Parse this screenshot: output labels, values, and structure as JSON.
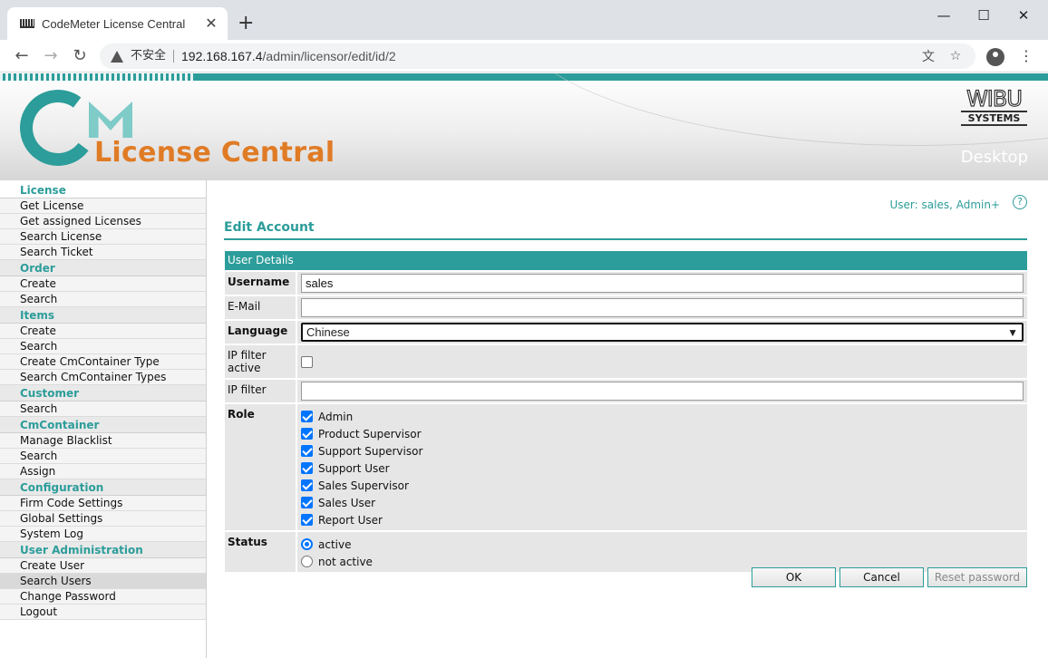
{
  "browser": {
    "tab_title": "CodeMeter License Central",
    "tab_close": "✕",
    "new_tab": "+",
    "minimize": "—",
    "maximize": "☐",
    "close": "✕",
    "back": "←",
    "forward": "→",
    "reload": "↻",
    "insecure_label": "不安全",
    "url_host": "192.168.167.4",
    "url_path": "/admin/licensor/edit/id/2",
    "translate_icon": "文",
    "star_icon": "☆",
    "menu_icon": "⋮"
  },
  "header": {
    "brand": "License Central",
    "vendor_top": "WIBU",
    "vendor_bottom": "SYSTEMS",
    "edition": "Desktop",
    "colors": {
      "teal": "#2c9d9a",
      "orange": "#e07b25",
      "light_teal": "#7ecbc8"
    }
  },
  "sidebar": {
    "license": {
      "title": "License",
      "items": [
        "Get License",
        "Get assigned Licenses",
        "Search License",
        "Search Ticket"
      ]
    },
    "order": {
      "title": "Order",
      "items": [
        "Create",
        "Search"
      ]
    },
    "items": {
      "title": "Items",
      "items": [
        "Create",
        "Search",
        "Create CmContainer Type",
        "Search CmContainer Types"
      ]
    },
    "customer": {
      "title": "Customer",
      "items": [
        "Search"
      ]
    },
    "cmcontainer": {
      "title": "CmContainer",
      "items": [
        "Manage Blacklist",
        "Search",
        "Assign"
      ]
    },
    "configuration": {
      "title": "Configuration",
      "items": [
        "Firm Code Settings",
        "Global Settings",
        "System Log"
      ]
    },
    "useradmin": {
      "title": "User Administration",
      "items": [
        "Create User",
        "Search Users",
        "Change Password",
        "Logout"
      ],
      "active_index": 1
    }
  },
  "main": {
    "user_info": "User: sales, Admin+",
    "help": "?",
    "title": "Edit Account",
    "section": "User Details",
    "fields": {
      "username_label": "Username",
      "username_value": "sales",
      "email_label": "E-Mail",
      "email_value": "",
      "language_label": "Language",
      "language_value": "Chinese",
      "ipfilter_active_label": "IP filter active",
      "ipfilter_active": false,
      "ipfilter_label": "IP filter",
      "ipfilter_value": ""
    },
    "role": {
      "label": "Role",
      "options": [
        "Admin",
        "Product Supervisor",
        "Support Supervisor",
        "Support User",
        "Sales Supervisor",
        "Sales User",
        "Report User"
      ],
      "checked": [
        true,
        true,
        true,
        true,
        true,
        true,
        true
      ]
    },
    "status": {
      "label": "Status",
      "options": [
        "active",
        "not active"
      ],
      "selected": "active"
    },
    "buttons": {
      "ok": "OK",
      "cancel": "Cancel",
      "reset": "Reset password"
    }
  }
}
